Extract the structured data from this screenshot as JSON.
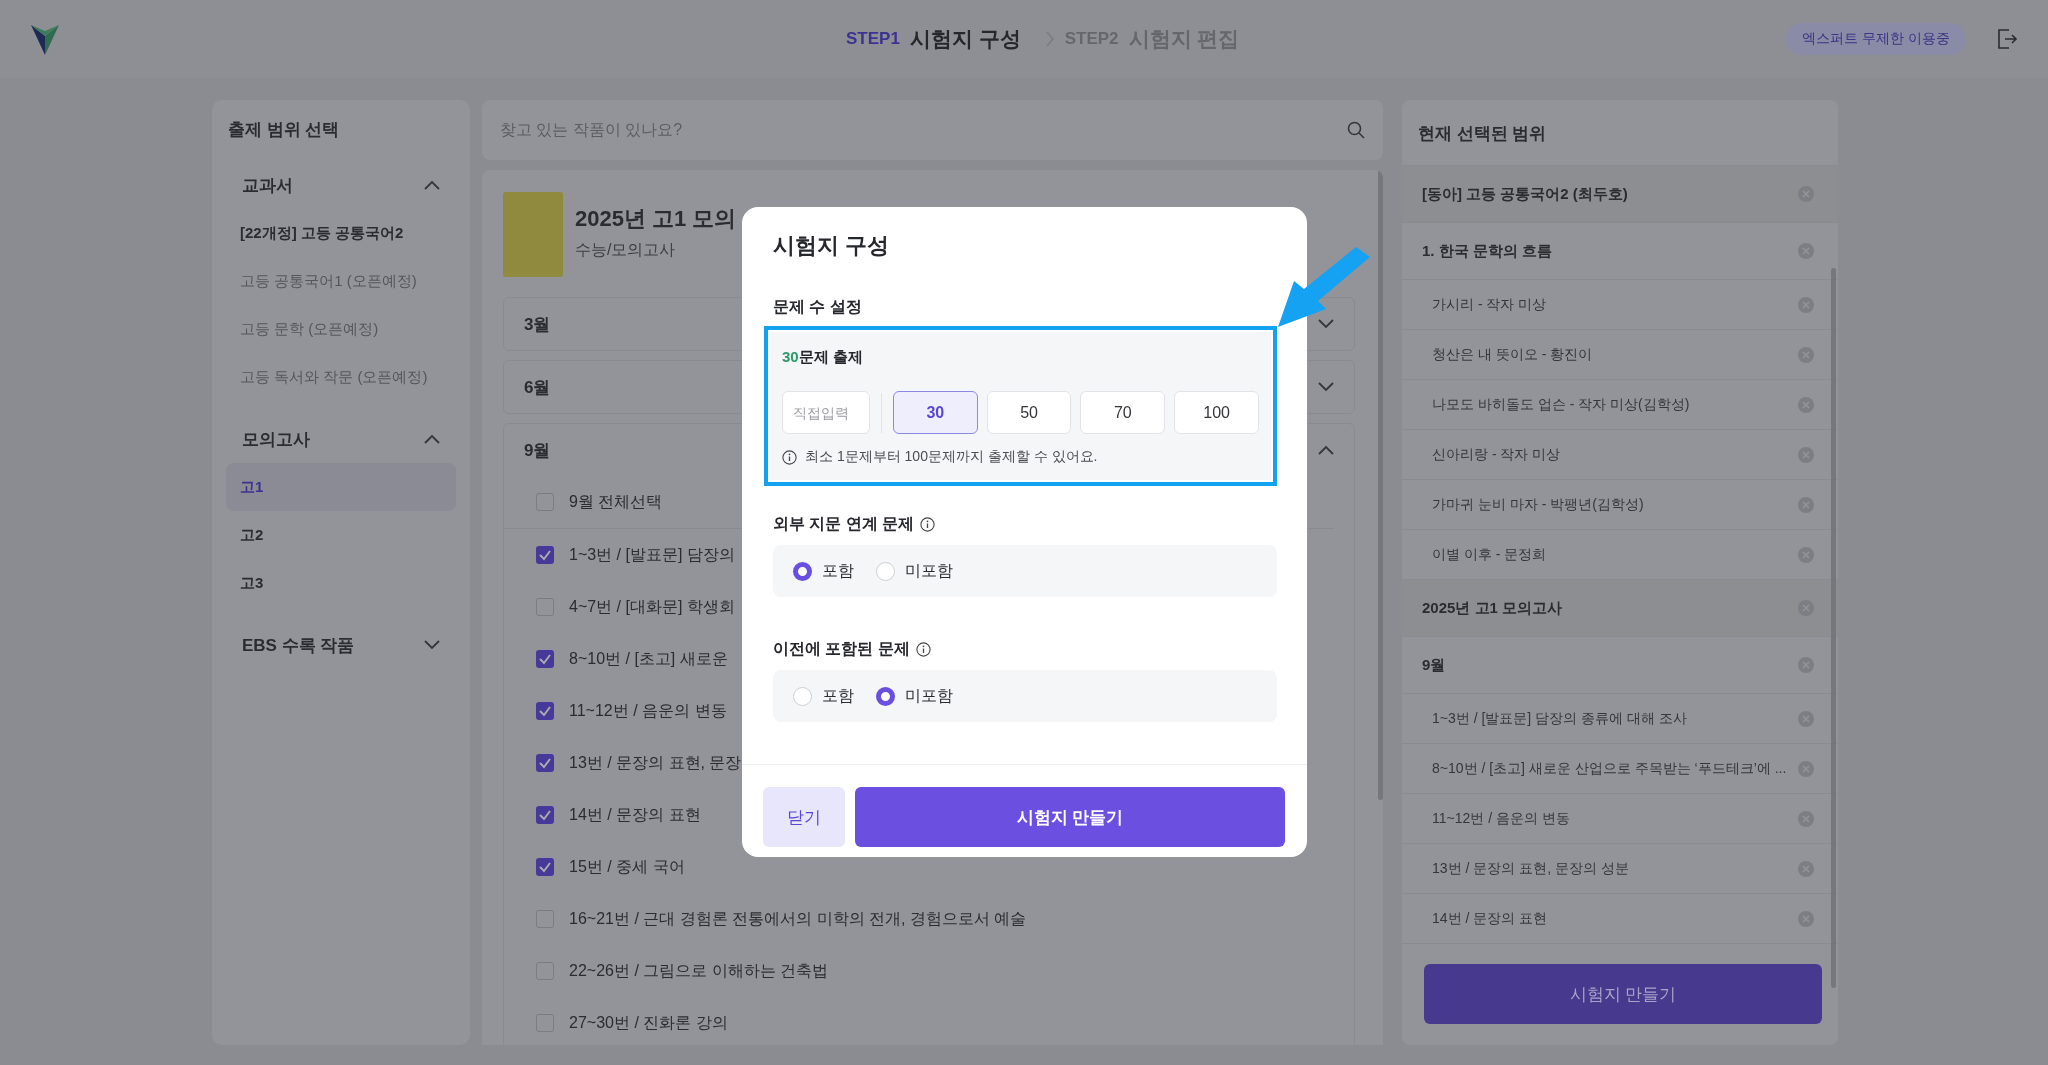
{
  "header": {
    "steps": [
      {
        "label": "STEP1",
        "title": "시험지 구성",
        "selected": true
      },
      {
        "label": "STEP2",
        "title": "시험지 편집",
        "selected": false
      }
    ],
    "badge": "엑스퍼트 무제한 이용중"
  },
  "sidebar": {
    "title": "출제 범위 선택",
    "groups": [
      {
        "label": "교과서",
        "expanded": true,
        "items": [
          {
            "label": "[22개정] 고등 공통국어2",
            "disabled": false,
            "selected": false
          },
          {
            "label": "고등 공통국어1 (오픈예정)",
            "disabled": true,
            "selected": false
          },
          {
            "label": "고등 문학 (오픈예정)",
            "disabled": true,
            "selected": false
          },
          {
            "label": "고등 독서와 작문 (오픈예정)",
            "disabled": true,
            "selected": false
          }
        ]
      },
      {
        "label": "모의고사",
        "expanded": true,
        "items": [
          {
            "label": "고1",
            "disabled": false,
            "selected": true
          },
          {
            "label": "고2",
            "disabled": false,
            "selected": false
          },
          {
            "label": "고3",
            "disabled": false,
            "selected": false
          }
        ]
      },
      {
        "label": "EBS 수록 작품",
        "expanded": false
      }
    ]
  },
  "search": {
    "placeholder": "찾고 있는 작품이 있나요?"
  },
  "book": {
    "title": "2025년 고1 모의",
    "subtitle": "수능/모의고사"
  },
  "months": [
    {
      "label": "3월",
      "expanded": false
    },
    {
      "label": "6월",
      "expanded": false
    },
    {
      "label": "9월",
      "expanded": true,
      "select_all": {
        "label": "9월 전체선택",
        "checked": false
      },
      "items": [
        {
          "label": "1~3번 / [발표문] 담장의",
          "checked": true
        },
        {
          "label": "4~7번 / [대화문] 학생회",
          "checked": false
        },
        {
          "label": "8~10번 / [초고] 새로운",
          "checked": true
        },
        {
          "label": "11~12번 / 음운의 변동",
          "checked": true
        },
        {
          "label": "13번 / 문장의 표현, 문장",
          "checked": true
        },
        {
          "label": "14번 / 문장의 표현",
          "checked": true
        },
        {
          "label": "15번 / 중세 국어",
          "checked": true
        },
        {
          "label": "16~21번 / 근대 경험론 전통에서의 미학의 전개, 경험으로서 예술",
          "checked": false
        },
        {
          "label": "22~26번 / 그림으로 이해하는 건축법",
          "checked": false
        },
        {
          "label": "27~30번 / 진화론 강의",
          "checked": false
        }
      ]
    }
  ],
  "scope": {
    "title": "현재 선택된 범위",
    "tree": [
      {
        "label": "[동아] 고등 공통국어2 (최두호)",
        "children": [
          {
            "label": "1. 한국 문학의 흐름",
            "children": [
              {
                "label": "가시리 - 작자 미상"
              },
              {
                "label": "청산은 내 뜻이오 - 황진이"
              },
              {
                "label": "나모도 바히돌도 업슨 - 작자 미상(김학성)"
              },
              {
                "label": "신아리랑 - 작자 미상"
              },
              {
                "label": "가마귀 눈비 마자 - 박팽년(김학성)"
              },
              {
                "label": "이별 이후 - 문정희"
              }
            ]
          }
        ]
      },
      {
        "label": "2025년 고1 모의고사",
        "children": [
          {
            "label": "9월",
            "children": [
              {
                "label": "1~3번 / [발표문] 담장의 종류에 대해 조사"
              },
              {
                "label": "8~10번 / [초고] 새로운 산업으로 주목받는 ‘푸드테크’에 ..."
              },
              {
                "label": "11~12번 / 음운의 변동"
              },
              {
                "label": "13번 / 문장의 표현, 문장의 성분"
              },
              {
                "label": "14번 / 문장의 표현"
              }
            ]
          }
        ]
      }
    ],
    "button": "시험지 만들기"
  },
  "modal": {
    "title": "시험지 구성",
    "count_section": {
      "title": "문제 수 설정",
      "count": "30",
      "count_suffix": "문제 출제",
      "input_placeholder": "직접입력",
      "options": [
        {
          "label": "30",
          "selected": true
        },
        {
          "label": "50",
          "selected": false
        },
        {
          "label": "70",
          "selected": false
        },
        {
          "label": "100",
          "selected": false
        }
      ],
      "hint": "최소 1문제부터 100문제까지 출제할 수 있어요."
    },
    "radio_sections": [
      {
        "title": "외부 지문 연계 문제",
        "options": [
          {
            "label": "포함",
            "selected": true
          },
          {
            "label": "미포함",
            "selected": false
          }
        ]
      },
      {
        "title": "이전에 포함된 문제",
        "options": [
          {
            "label": "포함",
            "selected": false
          },
          {
            "label": "미포함",
            "selected": true
          }
        ]
      }
    ],
    "close_button": "닫기",
    "submit_button": "시험지 만들기"
  }
}
